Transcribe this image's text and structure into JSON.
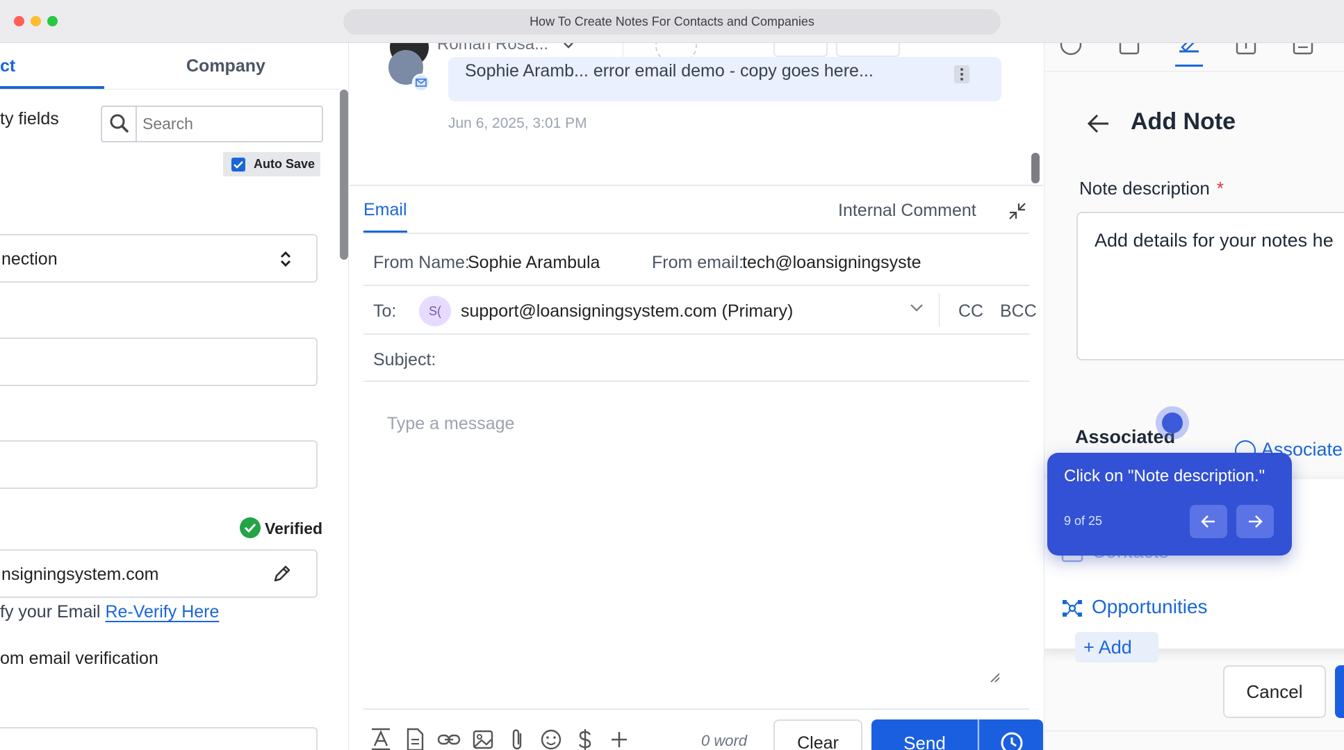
{
  "window": {
    "title": "How To Create Notes For Contacts and Companies"
  },
  "left_panel": {
    "tabs": {
      "contact": "ct",
      "company": "Company"
    },
    "fields_label": "ty fields",
    "search": {
      "placeholder": "Search"
    },
    "autosave_label": "Auto Save",
    "connection_select": "nection",
    "verified_label": "Verified",
    "email_value": "nsigningsystem.com",
    "reverify_text": "fy your Email",
    "reverify_link": "Re-Verify Here",
    "custom_verification": "om email verification"
  },
  "conversation": {
    "sender_name": "Roman Rosa...",
    "message_preview": "Sophie Aramb...    error email demo  -  copy goes here...",
    "timestamp": "Jun 6, 2025, 3:01 PM"
  },
  "composer": {
    "tabs": {
      "email": "Email",
      "internal": "Internal Comment"
    },
    "from_name_label": "From Name:",
    "from_name_value": "Sophie Arambula",
    "from_email_label": "From email:",
    "from_email_value": "tech@loansigningsyste",
    "to_label": "To:",
    "to_badge": "S(",
    "to_value": "support@loansigningsystem.com (Primary)",
    "cc_label": "CC",
    "bcc_label": "BCC",
    "subject_label": "Subject:",
    "message_placeholder": "Type a message",
    "word_count": "0 word",
    "clear_label": "Clear",
    "send_label": "Send"
  },
  "note_panel": {
    "title": "Add Note",
    "description_label": "Note description",
    "required_mark": "*",
    "description_placeholder": "Add details for your notes he",
    "associated_label": "Associated",
    "associate_link": "Associate",
    "dropdown": {
      "contacts": "Contacts",
      "opportunities": "Opportunities"
    },
    "add_label": "+ Add",
    "cancel_label": "Cancel"
  },
  "tooltip": {
    "message": "Click on \"Note description.\"",
    "step": "9 of 25"
  },
  "colors": {
    "accent": "#1a66d9",
    "send_button": "#1a5fe0",
    "tooltip_bg": "#3251d4",
    "verified_green": "#22a447",
    "required_red": "#e0323a"
  }
}
